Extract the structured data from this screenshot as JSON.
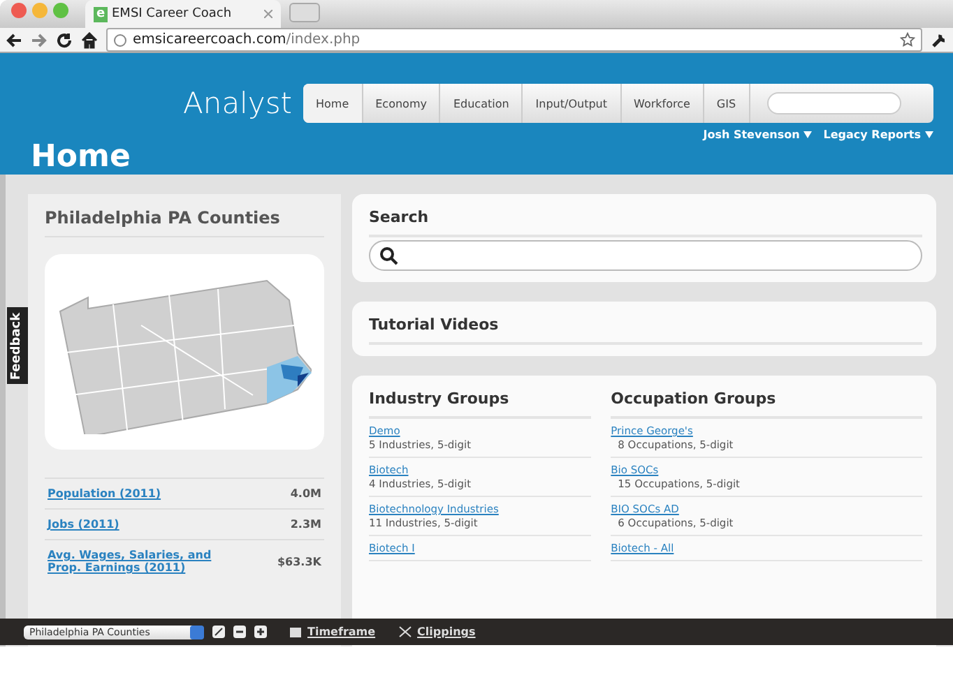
{
  "browser": {
    "tab_title": "EMSI Career Coach",
    "tab_logo": "e",
    "url_domain": "emsicareercoach.com",
    "url_path": "/index.php"
  },
  "header": {
    "brand": "Analyst",
    "page_title": "Home",
    "nav": [
      {
        "label": "Home",
        "selected": true
      },
      {
        "label": "Economy",
        "selected": false
      },
      {
        "label": "Education",
        "selected": false
      },
      {
        "label": "Input/Output",
        "selected": false
      },
      {
        "label": "Workforce",
        "selected": false
      },
      {
        "label": "GIS",
        "selected": false
      }
    ],
    "user_links": [
      "Josh Stevenson",
      "Legacy Reports"
    ]
  },
  "feedback": "Feedback",
  "region_panel": {
    "title": "Philadelphia PA Counties",
    "stats": [
      {
        "label": "Population (2011)",
        "value": "4.0M"
      },
      {
        "label": "Jobs (2011)",
        "value": "2.3M"
      },
      {
        "label": "Avg. Wages, Salaries, and Prop. Earnings (2011)",
        "value": "$63.3K"
      }
    ]
  },
  "search_card": {
    "title": "Search"
  },
  "tutorial_card": {
    "title": "Tutorial Videos"
  },
  "groups": [
    {
      "title": "Industry Groups",
      "items": [
        {
          "name": "Demo",
          "detail": "5 Industries, 5-digit"
        },
        {
          "name": "Biotech",
          "detail": "4 Industries, 5-digit"
        },
        {
          "name": "Biotechnology Industries",
          "detail": "11 Industries, 5-digit"
        },
        {
          "name": "Biotech I"
        }
      ]
    },
    {
      "title": "Occupation Groups",
      "items": [
        {
          "name": "Prince George's",
          "detail": "8 Occupations, 5-digit"
        },
        {
          "name": "Bio SOCs",
          "detail": "15 Occupations, 5-digit"
        },
        {
          "name": "BIO SOCs AD",
          "detail": "6 Occupations, 5-digit"
        },
        {
          "name": "Biotech - All"
        }
      ]
    }
  ],
  "bottom_bar": {
    "region_select": "Philadelphia PA Counties",
    "links": [
      "Timeframe",
      "Clippings"
    ]
  }
}
